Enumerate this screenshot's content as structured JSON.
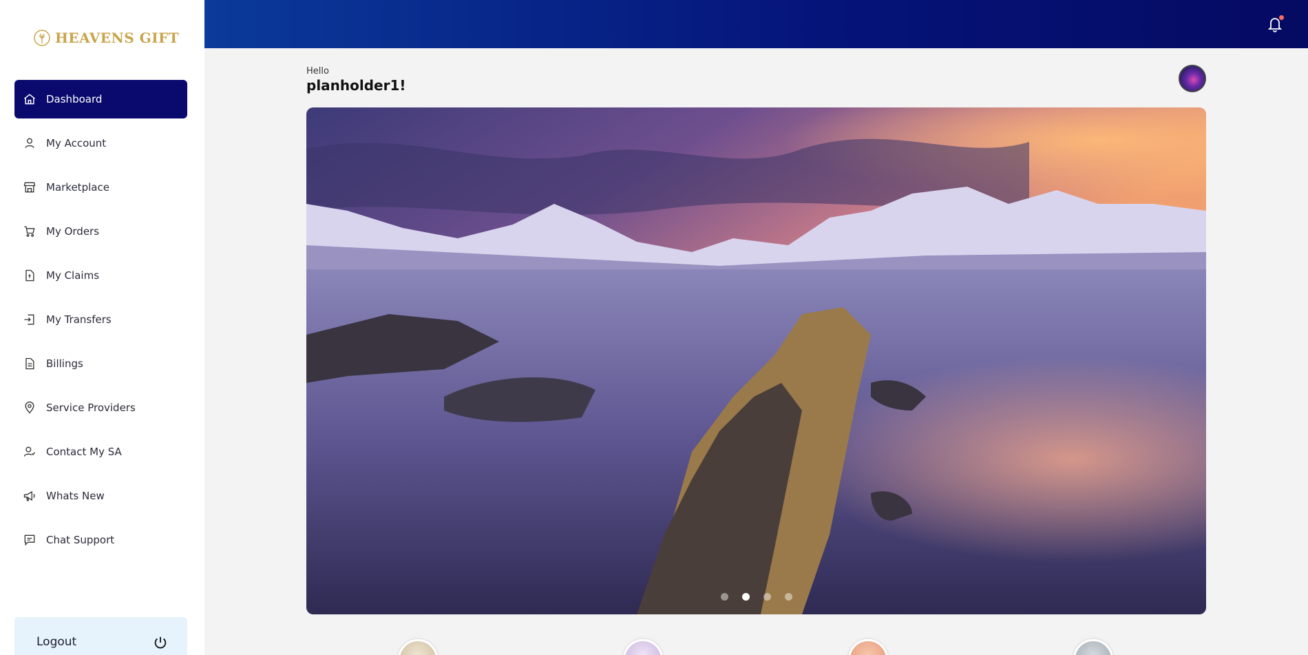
{
  "brand": {
    "name": "HEAVENS GIFT",
    "color": "#c9a44a"
  },
  "greeting": {
    "hello": "Hello",
    "username": "planholder1!"
  },
  "sidebar": {
    "items": [
      {
        "label": "Dashboard",
        "icon": "home-icon",
        "active": true
      },
      {
        "label": "My Account",
        "icon": "user-icon"
      },
      {
        "label": "Marketplace",
        "icon": "store-icon"
      },
      {
        "label": "My Orders",
        "icon": "cart-icon"
      },
      {
        "label": "My Claims",
        "icon": "claim-file-icon"
      },
      {
        "label": "My Transfers",
        "icon": "transfer-icon"
      },
      {
        "label": "Billings",
        "icon": "billing-icon"
      },
      {
        "label": "Service Providers",
        "icon": "location-pin-icon"
      },
      {
        "label": "Contact My SA",
        "icon": "contact-user-icon"
      },
      {
        "label": "Whats New",
        "icon": "megaphone-icon"
      },
      {
        "label": "Chat Support",
        "icon": "chat-icon"
      }
    ],
    "logout_label": "Logout"
  },
  "carousel": {
    "slide_count": 4,
    "active_index": 1
  },
  "colors": {
    "active_nav": "#0a0a6e",
    "topbar_start": "#0a3a9a",
    "topbar_end": "#050a62",
    "logout_bg": "#e6f3fd"
  }
}
